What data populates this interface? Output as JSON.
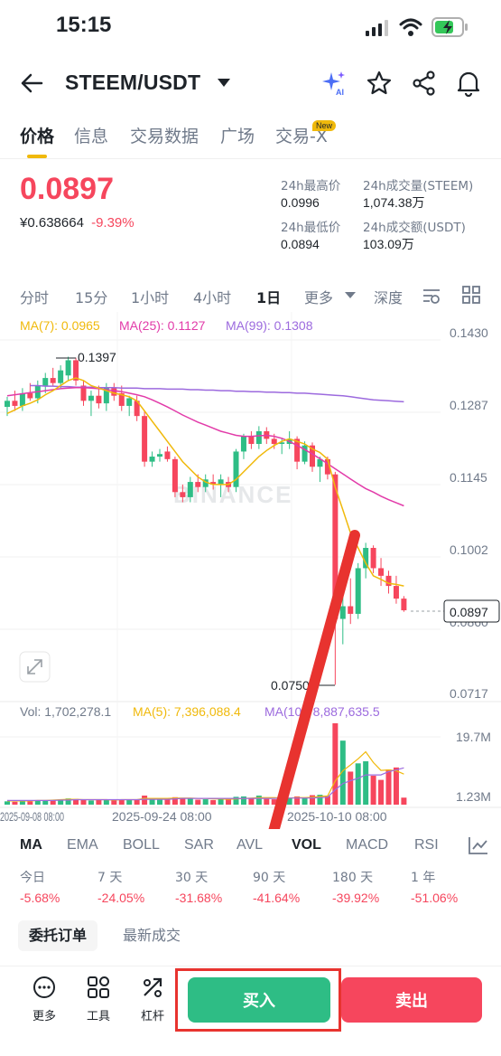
{
  "status_bar": {
    "time": "15:15"
  },
  "header": {
    "pair": "STEEM/USDT"
  },
  "tabs": [
    {
      "label": "价格"
    },
    {
      "label": "信息"
    },
    {
      "label": "交易数据"
    },
    {
      "label": "广场"
    },
    {
      "label": "交易-X"
    }
  ],
  "tab_badge": "New",
  "price": {
    "last": "0.0897",
    "cny": "¥0.638664",
    "change": "-9.39%"
  },
  "stats": {
    "high_label": "24h最高价",
    "high_value": "0.0996",
    "low_label": "24h最低价",
    "low_value": "0.0894",
    "vol_label": "24h成交量(STEEM)",
    "vol_value": "1,074.38万",
    "amt_label": "24h成交额(USDT)",
    "amt_value": "103.09万"
  },
  "intervals": [
    "分时",
    "15分",
    "1小时",
    "4小时",
    "1日",
    "更多",
    "深度"
  ],
  "ma_legend": {
    "ma7": "MA(7): 0.0965",
    "ma25": "MA(25): 0.1127",
    "ma99": "MA(99): 0.1308"
  },
  "vol_legend": {
    "vol": "Vol: 1,702,278.1",
    "ma5": "MA(5): 7,396,088.4",
    "ma10": "MA(10): 8,887,635.5"
  },
  "watermark": "BINANCE",
  "chart_data": {
    "type": "candlestick",
    "price_axis_ticks": [
      "0.1430",
      "0.1287",
      "0.1145",
      "0.1002",
      "0.0860",
      "0.0717"
    ],
    "volume_axis_ticks": [
      "19.7M",
      "1.23M"
    ],
    "x_tick_labels": [
      "2025-09-08 08:00",
      "2025-09-24 08:00",
      "2025-10-10 08:00"
    ],
    "high_marker": "0.1397",
    "low_marker": "0.0750",
    "last_price_tag": "0.0897",
    "candles": [
      {
        "o": 0.1298,
        "h": 0.1318,
        "l": 0.128,
        "c": 0.131
      },
      {
        "o": 0.131,
        "h": 0.133,
        "l": 0.129,
        "c": 0.13
      },
      {
        "o": 0.13,
        "h": 0.1335,
        "l": 0.129,
        "c": 0.1325
      },
      {
        "o": 0.1325,
        "h": 0.1345,
        "l": 0.131,
        "c": 0.1315
      },
      {
        "o": 0.1315,
        "h": 0.135,
        "l": 0.1305,
        "c": 0.134
      },
      {
        "o": 0.134,
        "h": 0.1365,
        "l": 0.1325,
        "c": 0.1355
      },
      {
        "o": 0.1355,
        "h": 0.1375,
        "l": 0.134,
        "c": 0.1345
      },
      {
        "o": 0.1345,
        "h": 0.138,
        "l": 0.1335,
        "c": 0.137
      },
      {
        "o": 0.136,
        "h": 0.1397,
        "l": 0.135,
        "c": 0.139
      },
      {
        "o": 0.139,
        "h": 0.1395,
        "l": 0.134,
        "c": 0.135
      },
      {
        "o": 0.134,
        "h": 0.135,
        "l": 0.13,
        "c": 0.131
      },
      {
        "o": 0.131,
        "h": 0.133,
        "l": 0.128,
        "c": 0.132
      },
      {
        "o": 0.132,
        "h": 0.134,
        "l": 0.1295,
        "c": 0.1305
      },
      {
        "o": 0.1305,
        "h": 0.1345,
        "l": 0.129,
        "c": 0.1335
      },
      {
        "o": 0.1335,
        "h": 0.1345,
        "l": 0.131,
        "c": 0.132
      },
      {
        "o": 0.1325,
        "h": 0.134,
        "l": 0.129,
        "c": 0.13
      },
      {
        "o": 0.13,
        "h": 0.132,
        "l": 0.128,
        "c": 0.1315
      },
      {
        "o": 0.131,
        "h": 0.132,
        "l": 0.127,
        "c": 0.128
      },
      {
        "o": 0.128,
        "h": 0.129,
        "l": 0.118,
        "c": 0.119
      },
      {
        "o": 0.119,
        "h": 0.121,
        "l": 0.118,
        "c": 0.12
      },
      {
        "o": 0.12,
        "h": 0.1215,
        "l": 0.119,
        "c": 0.1205
      },
      {
        "o": 0.121,
        "h": 0.122,
        "l": 0.119,
        "c": 0.1195
      },
      {
        "o": 0.1195,
        "h": 0.12,
        "l": 0.112,
        "c": 0.113
      },
      {
        "o": 0.113,
        "h": 0.1145,
        "l": 0.111,
        "c": 0.112
      },
      {
        "o": 0.112,
        "h": 0.116,
        "l": 0.111,
        "c": 0.115
      },
      {
        "o": 0.115,
        "h": 0.1165,
        "l": 0.113,
        "c": 0.114
      },
      {
        "o": 0.114,
        "h": 0.1165,
        "l": 0.113,
        "c": 0.1155
      },
      {
        "o": 0.115,
        "h": 0.1165,
        "l": 0.1135,
        "c": 0.1145
      },
      {
        "o": 0.1145,
        "h": 0.1165,
        "l": 0.112,
        "c": 0.1155
      },
      {
        "o": 0.115,
        "h": 0.116,
        "l": 0.113,
        "c": 0.114
      },
      {
        "o": 0.114,
        "h": 0.1215,
        "l": 0.113,
        "c": 0.121
      },
      {
        "o": 0.121,
        "h": 0.1245,
        "l": 0.1195,
        "c": 0.124
      },
      {
        "o": 0.124,
        "h": 0.125,
        "l": 0.1215,
        "c": 0.1225
      },
      {
        "o": 0.1225,
        "h": 0.126,
        "l": 0.1215,
        "c": 0.125
      },
      {
        "o": 0.125,
        "h": 0.1258,
        "l": 0.1225,
        "c": 0.1235
      },
      {
        "o": 0.1235,
        "h": 0.1245,
        "l": 0.1215,
        "c": 0.1225
      },
      {
        "o": 0.1225,
        "h": 0.1235,
        "l": 0.1205,
        "c": 0.1228
      },
      {
        "o": 0.1225,
        "h": 0.125,
        "l": 0.1215,
        "c": 0.1235
      },
      {
        "o": 0.1235,
        "h": 0.124,
        "l": 0.1175,
        "c": 0.119
      },
      {
        "o": 0.119,
        "h": 0.123,
        "l": 0.1185,
        "c": 0.1222
      },
      {
        "o": 0.1222,
        "h": 0.1228,
        "l": 0.117,
        "c": 0.118
      },
      {
        "o": 0.118,
        "h": 0.12,
        "l": 0.115,
        "c": 0.1195
      },
      {
        "o": 0.1195,
        "h": 0.12,
        "l": 0.1155,
        "c": 0.1165
      },
      {
        "o": 0.1165,
        "h": 0.117,
        "l": 0.075,
        "c": 0.088
      },
      {
        "o": 0.088,
        "h": 0.093,
        "l": 0.083,
        "c": 0.0905
      },
      {
        "o": 0.0905,
        "h": 0.096,
        "l": 0.087,
        "c": 0.089
      },
      {
        "o": 0.089,
        "h": 0.099,
        "l": 0.088,
        "c": 0.098
      },
      {
        "o": 0.098,
        "h": 0.103,
        "l": 0.096,
        "c": 0.102
      },
      {
        "o": 0.102,
        "h": 0.1025,
        "l": 0.097,
        "c": 0.098
      },
      {
        "o": 0.098,
        "h": 0.1,
        "l": 0.0945,
        "c": 0.0965
      },
      {
        "o": 0.0965,
        "h": 0.0975,
        "l": 0.093,
        "c": 0.0945
      },
      {
        "o": 0.0945,
        "h": 0.0965,
        "l": 0.091,
        "c": 0.092
      },
      {
        "o": 0.092,
        "h": 0.0925,
        "l": 0.0894,
        "c": 0.0897
      }
    ],
    "ma7": [
      0.1285,
      0.1292,
      0.13,
      0.1305,
      0.1312,
      0.1322,
      0.133,
      0.134,
      0.135,
      0.1355,
      0.135,
      0.134,
      0.1335,
      0.133,
      0.1325,
      0.1322,
      0.1318,
      0.131,
      0.129,
      0.127,
      0.125,
      0.123,
      0.121,
      0.119,
      0.1175,
      0.116,
      0.115,
      0.1145,
      0.1145,
      0.1145,
      0.1155,
      0.117,
      0.1185,
      0.12,
      0.1212,
      0.1222,
      0.123,
      0.1235,
      0.123,
      0.1225,
      0.1215,
      0.1208,
      0.1195,
      0.114,
      0.1095,
      0.105,
      0.102,
      0.099,
      0.0965,
      0.0958,
      0.095,
      0.0948,
      0.0945
    ],
    "ma25": [
      0.132,
      0.1322,
      0.1324,
      0.1326,
      0.1328,
      0.133,
      0.1332,
      0.1334,
      0.1335,
      0.1336,
      0.1336,
      0.1335,
      0.1334,
      0.1332,
      0.133,
      0.1328,
      0.1325,
      0.1322,
      0.1318,
      0.1312,
      0.1305,
      0.1298,
      0.129,
      0.1282,
      0.1275,
      0.1268,
      0.1262,
      0.1256,
      0.125,
      0.1246,
      0.1242,
      0.124,
      0.124,
      0.1241,
      0.1242,
      0.124,
      0.1236,
      0.123,
      0.1222,
      0.1214,
      0.1205,
      0.1196,
      0.1186,
      0.1176,
      0.1166,
      0.1156,
      0.1146,
      0.1137,
      0.113,
      0.1122,
      0.1115,
      0.1109,
      0.1103
    ],
    "ma99": [
      0.134,
      0.134,
      0.1339,
      0.1339,
      0.1338,
      0.1338,
      0.1337,
      0.1337,
      0.1337,
      0.1336,
      0.1336,
      0.1336,
      0.1335,
      0.1335,
      0.1335,
      0.1334,
      0.1334,
      0.1334,
      0.1333,
      0.1333,
      0.1333,
      0.1332,
      0.1332,
      0.1331,
      0.1331,
      0.133,
      0.133,
      0.1329,
      0.1329,
      0.1328,
      0.1328,
      0.1327,
      0.1327,
      0.1326,
      0.1326,
      0.1325,
      0.1325,
      0.1324,
      0.1323,
      0.1322,
      0.1321,
      0.132,
      0.1318,
      0.1316,
      0.1314,
      0.1312,
      0.1311,
      0.131,
      0.1309,
      0.1308
    ],
    "volumes_m": [
      0.8,
      0.7,
      0.9,
      0.8,
      1.0,
      0.9,
      1.1,
      1.2,
      1.5,
      1.4,
      1.2,
      1.0,
      1.1,
      1.3,
      1.0,
      1.2,
      1.1,
      1.3,
      2.2,
      1.4,
      1.2,
      1.3,
      1.8,
      1.5,
      1.6,
      1.2,
      1.3,
      1.1,
      1.4,
      1.2,
      1.9,
      2.0,
      1.6,
      2.2,
      1.4,
      1.3,
      1.5,
      1.6,
      2.0,
      1.7,
      2.3,
      2.4,
      2.1,
      19.7,
      15.5,
      8.0,
      10.0,
      10.5,
      7.0,
      6.0,
      8.5,
      9.0,
      1.7
    ],
    "vol_ma5_m": [
      0.9,
      0.9,
      0.9,
      0.9,
      1.0,
      1.0,
      1.1,
      1.2,
      1.3,
      1.3,
      1.2,
      1.2,
      1.2,
      1.2,
      1.1,
      1.2,
      1.2,
      1.2,
      1.5,
      1.5,
      1.5,
      1.5,
      1.6,
      1.6,
      1.6,
      1.5,
      1.5,
      1.4,
      1.4,
      1.3,
      1.4,
      1.5,
      1.6,
      1.7,
      1.7,
      1.7,
      1.6,
      1.6,
      1.7,
      1.7,
      1.8,
      2.0,
      2.1,
      5.7,
      8.2,
      9.6,
      11.1,
      12.8,
      10.2,
      8.3,
      8.4,
      8.2,
      7.4
    ],
    "vol_ma10_m": [
      1.0,
      1.0,
      1.0,
      1.0,
      1.0,
      1.0,
      1.0,
      1.1,
      1.1,
      1.2,
      1.2,
      1.2,
      1.2,
      1.2,
      1.2,
      1.2,
      1.2,
      1.2,
      1.3,
      1.3,
      1.3,
      1.3,
      1.4,
      1.5,
      1.5,
      1.5,
      1.5,
      1.5,
      1.5,
      1.5,
      1.5,
      1.5,
      1.5,
      1.5,
      1.5,
      1.5,
      1.6,
      1.6,
      1.6,
      1.6,
      1.6,
      1.7,
      1.8,
      3.6,
      5.1,
      5.8,
      6.4,
      7.2,
      7.2,
      7.2,
      8.0,
      8.4,
      8.9
    ]
  },
  "indicators": [
    "MA",
    "EMA",
    "BOLL",
    "SAR",
    "AVL",
    "VOL",
    "MACD",
    "RSI"
  ],
  "performance": [
    {
      "label": "今日",
      "value": "-5.68%"
    },
    {
      "label": "7 天",
      "value": "-24.05%"
    },
    {
      "label": "30 天",
      "value": "-31.68%"
    },
    {
      "label": "90 天",
      "value": "-41.64%"
    },
    {
      "label": "180 天",
      "value": "-39.92%"
    },
    {
      "label": "1 年",
      "value": "-51.06%"
    }
  ],
  "order_tabs": [
    "委托订单",
    "最新成交"
  ],
  "bottom": {
    "more": "更多",
    "tools": "工具",
    "leverage": "杠杆",
    "buy": "买入",
    "sell": "卖出"
  },
  "colors": {
    "up": "#2ebd85",
    "down": "#f6465d",
    "ma7": "#f0b90b",
    "ma25": "#e23ba9",
    "ma99": "#9c6ade",
    "annotation": "#e8332f"
  }
}
